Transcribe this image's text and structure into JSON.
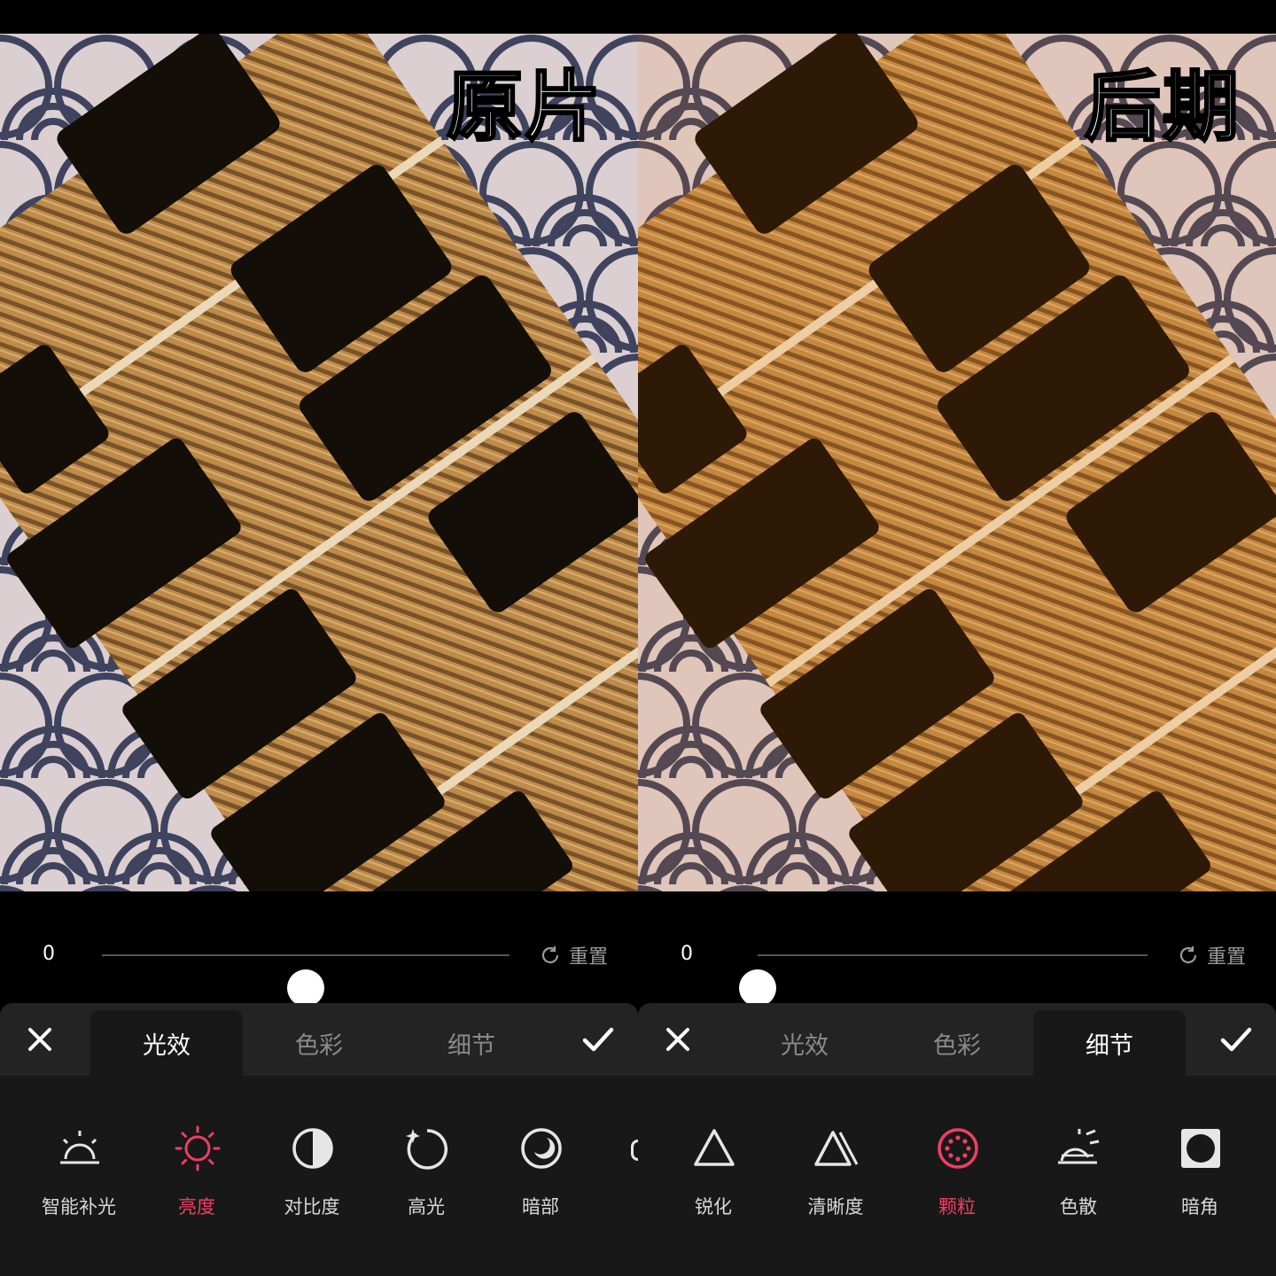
{
  "left_panel": {
    "caption": "原片",
    "slider": {
      "value_label": "0",
      "position": 0.5
    },
    "reset_label": "重置",
    "tabs": [
      {
        "label": "光效",
        "active": true
      },
      {
        "label": "色彩",
        "active": false
      },
      {
        "label": "细节",
        "active": false
      }
    ],
    "tools": [
      {
        "label": "智能补光",
        "icon": "smart-fill-light-icon",
        "selected": false
      },
      {
        "label": "亮度",
        "icon": "brightness-sun-icon",
        "selected": true
      },
      {
        "label": "对比度",
        "icon": "contrast-icon",
        "selected": false
      },
      {
        "label": "高光",
        "icon": "highlight-icon",
        "selected": false
      },
      {
        "label": "暗部",
        "icon": "shadow-moon-icon",
        "selected": false
      }
    ]
  },
  "right_panel": {
    "caption": "后期",
    "slider": {
      "value_label": "0",
      "position": 0.0
    },
    "reset_label": "重置",
    "tabs": [
      {
        "label": "光效",
        "active": false
      },
      {
        "label": "色彩",
        "active": false
      },
      {
        "label": "细节",
        "active": true
      }
    ],
    "tools": [
      {
        "label": "锐化",
        "icon": "sharpen-triangle-icon",
        "selected": false
      },
      {
        "label": "清晰度",
        "icon": "clarity-icon",
        "selected": false
      },
      {
        "label": "颗粒",
        "icon": "grain-icon",
        "selected": true
      },
      {
        "label": "色散",
        "icon": "dispersion-icon",
        "selected": false
      },
      {
        "label": "暗角",
        "icon": "vignette-icon",
        "selected": false
      }
    ]
  },
  "colors": {
    "accent": "#ee3f63",
    "panel_bg": "#181818",
    "tabbar_bg": "#232323"
  }
}
